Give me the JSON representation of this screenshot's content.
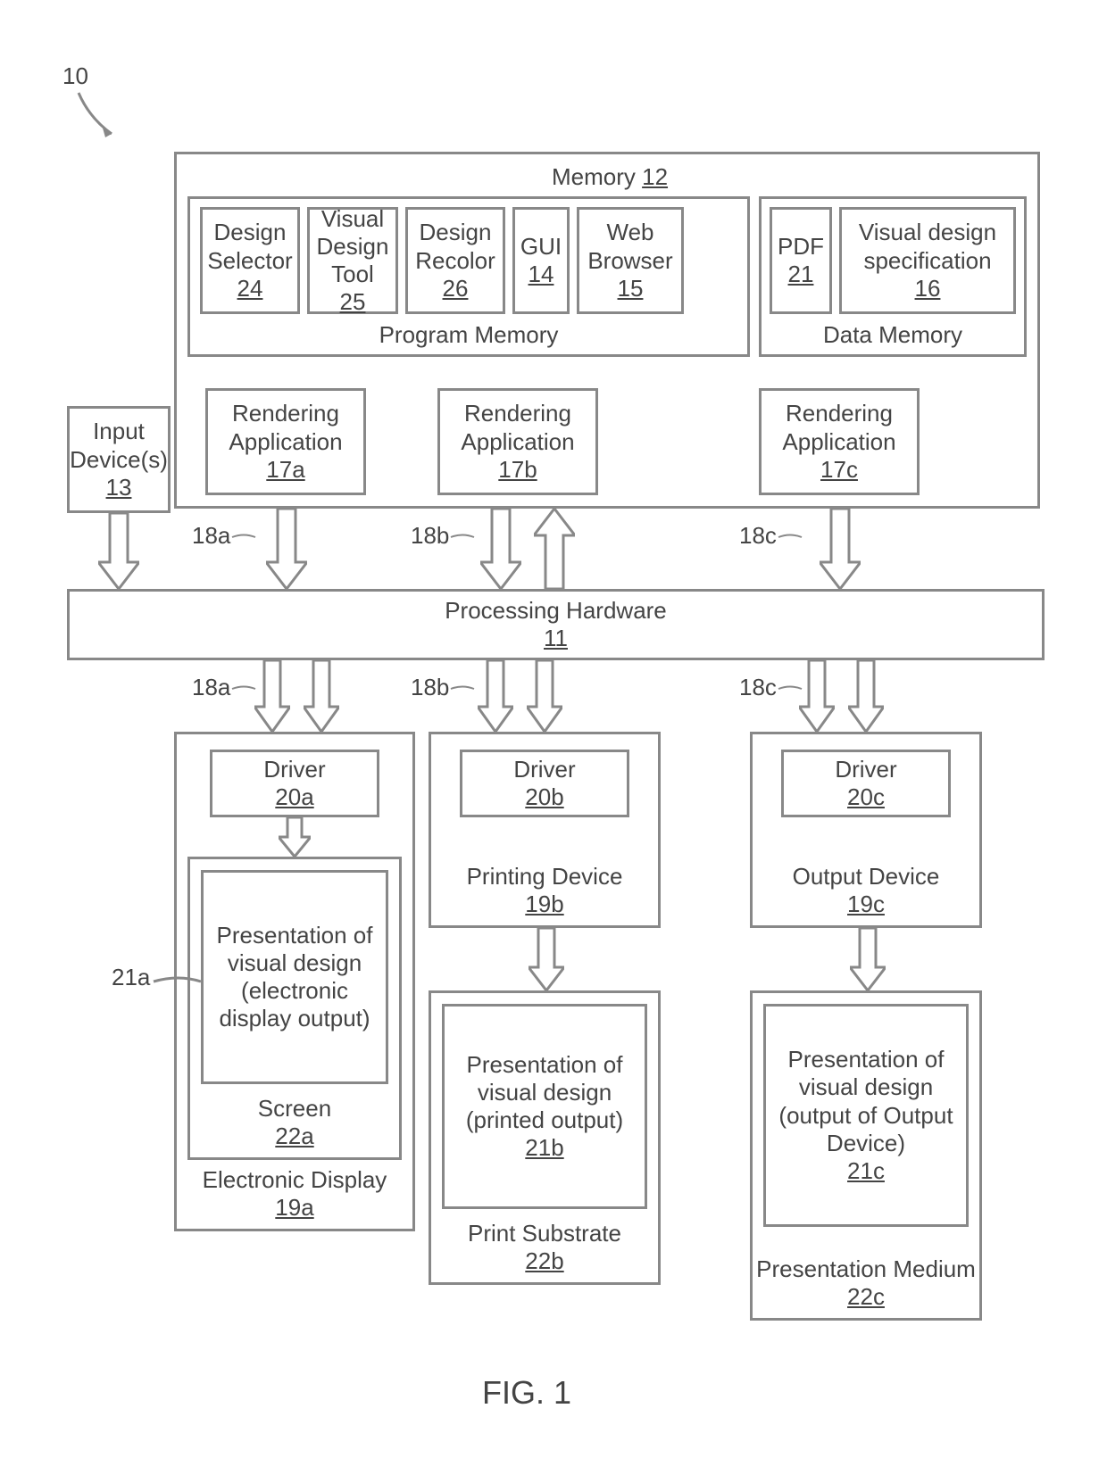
{
  "ref10": "10",
  "memory": {
    "label": "Memory",
    "num": "12"
  },
  "progmem": "Program Memory",
  "datamem": "Data Memory",
  "designSelector": {
    "label": "Design Selector",
    "num": "24"
  },
  "visualDesignTool": {
    "label": "Visual Design Tool",
    "num": "25"
  },
  "designRecolor": {
    "label": "Design Recolor",
    "num": "26"
  },
  "gui": {
    "label": "GUI",
    "num": "14"
  },
  "webBrowser": {
    "label": "Web Browser",
    "num": "15"
  },
  "pdf": {
    "label": "PDF",
    "num": "21"
  },
  "vds": {
    "label": "Visual design specification",
    "num": "16"
  },
  "renderA": {
    "label": "Rendering Application",
    "num": "17a"
  },
  "renderB": {
    "label": "Rendering Application",
    "num": "17b"
  },
  "renderC": {
    "label": "Rendering Application",
    "num": "17c"
  },
  "inputDev": {
    "label": "Input Device(s)",
    "num": "13"
  },
  "c18a": "18a",
  "c18b": "18b",
  "c18c": "18c",
  "procHw": {
    "label": "Processing Hardware",
    "num": "11"
  },
  "driverA": {
    "label": "Driver",
    "num": "20a"
  },
  "driverB": {
    "label": "Driver",
    "num": "20b"
  },
  "driverC": {
    "label": "Driver",
    "num": "20c"
  },
  "printingDevice": {
    "label": "Printing Device",
    "num": "19b"
  },
  "outputDevice": {
    "label": "Output Device",
    "num": "19c"
  },
  "presentA": {
    "label": "Presentation of visual design (electronic display output)"
  },
  "screen": {
    "label": "Screen",
    "num": "22a"
  },
  "elecDisplay": {
    "label": "Electronic Display",
    "num": "19a"
  },
  "ref21a": "21a",
  "presentB": {
    "label": "Presentation of visual design (printed output)",
    "num": "21b"
  },
  "printSubstrate": {
    "label": "Print Substrate",
    "num": "22b"
  },
  "presentC": {
    "label": "Presentation of visual design (output of Output Device)",
    "num": "21c"
  },
  "presMedium": {
    "label": "Presentation Medium",
    "num": "22c"
  },
  "figLabel": "FIG. 1"
}
